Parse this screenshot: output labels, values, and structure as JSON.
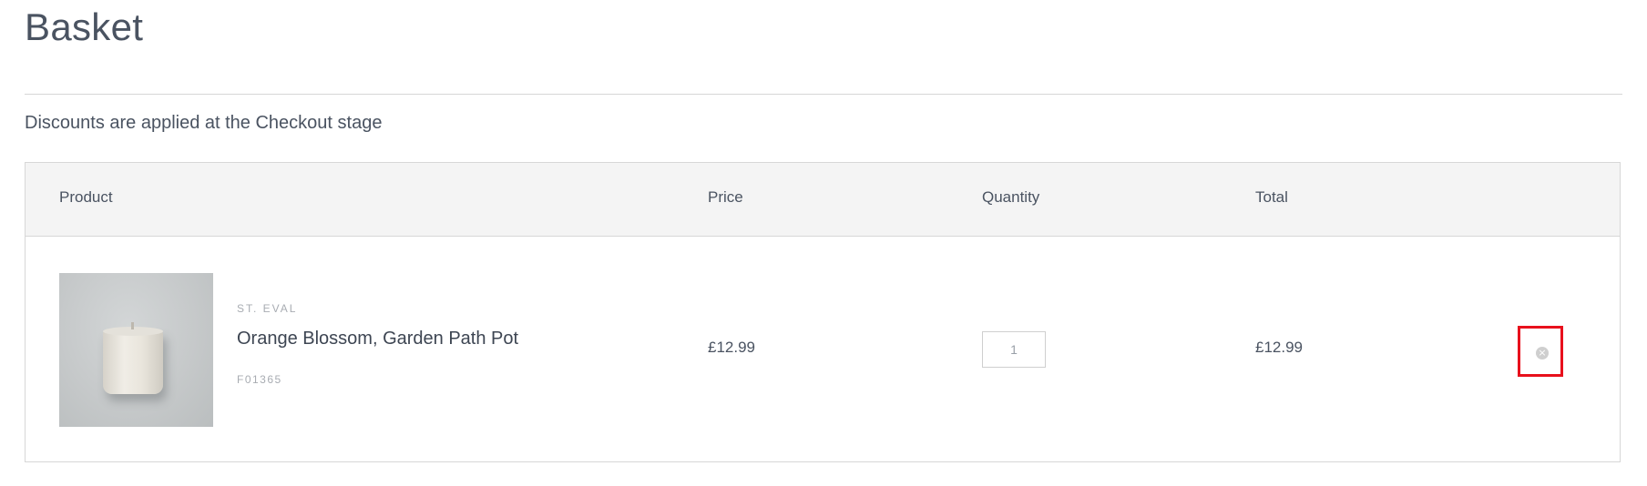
{
  "page": {
    "title": "Basket",
    "discount_note": "Discounts are applied at the Checkout stage"
  },
  "table": {
    "headers": {
      "product": "Product",
      "price": "Price",
      "quantity": "Quantity",
      "total": "Total"
    },
    "items": [
      {
        "brand": "ST. EVAL",
        "name": "Orange Blossom, Garden Path Pot",
        "sku": "F01365",
        "price": "£12.99",
        "quantity": "1",
        "total": "£12.99",
        "image_icon": "candle-pot-image",
        "remove_icon": "close-circle-icon"
      }
    ]
  },
  "colors": {
    "text": "#4a5361",
    "muted_text": "#a8acb2",
    "header_background": "#f4f4f4",
    "border": "#d7d7d7",
    "highlight": "#e8101c"
  }
}
